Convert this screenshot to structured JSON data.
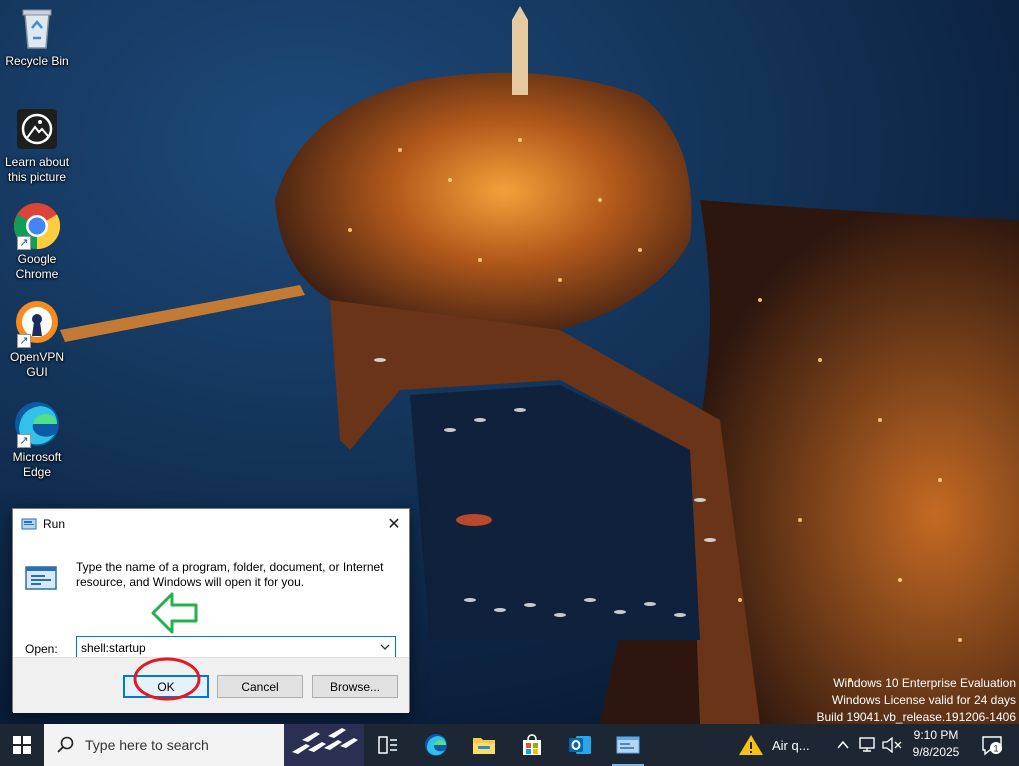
{
  "desktop": {
    "icons": [
      {
        "label": "Recycle Bin",
        "icon": "recycle-bin-icon"
      },
      {
        "label": "Learn about this picture",
        "icon": "camera-icon"
      },
      {
        "label": "Google Chrome",
        "icon": "chrome-icon"
      },
      {
        "label": "OpenVPN GUI",
        "icon": "openvpn-icon"
      },
      {
        "label": "Microsoft Edge",
        "icon": "edge-icon"
      }
    ]
  },
  "watermark": {
    "line1": "Windows 10 Enterprise Evaluation",
    "line2": "Windows License valid for 24 days",
    "line3": "Build 19041.vb_release.191206-1406"
  },
  "run_dialog": {
    "title": "Run",
    "description": "Type the name of a program, folder, document, or Internet resource, and Windows will open it for you.",
    "open_label": "Open:",
    "open_value": "shell:startup",
    "ok_label": "OK",
    "cancel_label": "Cancel",
    "browse_label": "Browse..."
  },
  "annotations": {
    "arrow_color": "#22b14c",
    "circle_color": "#e01b24"
  },
  "taskbar": {
    "search_placeholder": "Type here to search",
    "apps": [
      "task-view-icon",
      "edge-icon",
      "file-explorer-icon",
      "store-icon",
      "outlook-icon",
      "run-icon"
    ],
    "weather_text": "Air q...",
    "time": "9:10 PM",
    "date": "9/8/2025",
    "notification_count": "1"
  },
  "colors": {
    "accent": "#0078d7",
    "taskbar": "#1c2733"
  }
}
